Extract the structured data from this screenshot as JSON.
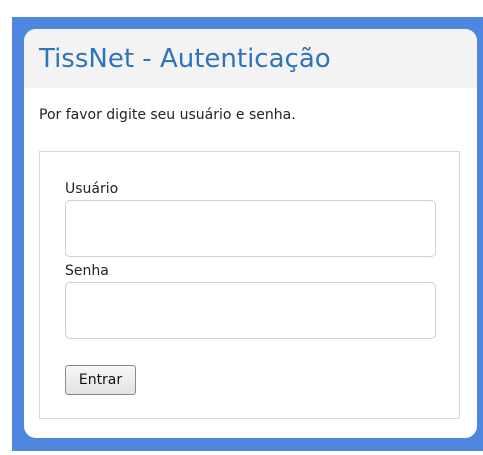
{
  "header": {
    "title": "TissNet - Autenticação"
  },
  "instructions": "Por favor digite seu usuário e senha.",
  "form": {
    "username_label": "Usuário",
    "username_value": "",
    "password_label": "Senha",
    "password_value": "",
    "submit_label": "Entrar"
  },
  "colors": {
    "frame_blue": "#4f86e0",
    "title_blue": "#2f73b8",
    "header_bg": "#f3f3f3"
  }
}
